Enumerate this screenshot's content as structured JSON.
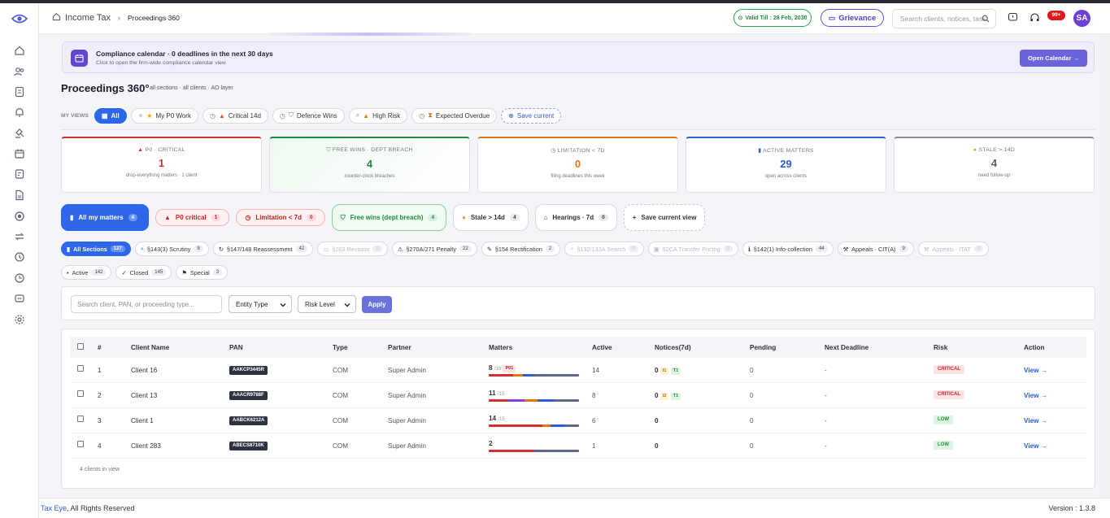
{
  "header": {
    "breadcrumb_root": "Income Tax",
    "breadcrumb_current": "Proceedings 360",
    "valid_till": "Valid Till : 28 Feb, 2030",
    "grievance": "Grievance",
    "search_placeholder": "Search clients, notices, task",
    "notif_badge": "99+",
    "avatar": "SA"
  },
  "sidebar": {
    "icons": [
      "home-icon",
      "users-icon",
      "document-icon",
      "bell-icon",
      "gavel-icon",
      "calendar-icon",
      "notes-icon",
      "file-icon",
      "target-icon",
      "transfer-icon",
      "clock-icon",
      "history-icon",
      "message-icon",
      "settings-icon"
    ]
  },
  "calendar_banner": {
    "title": "Compliance calendar · 0 deadlines in the next 30 days",
    "subtitle": "Click to open the firm-wide compliance calendar view",
    "button": "Open Calendar →"
  },
  "page": {
    "title": "Proceedings 360°",
    "subtitle": "all sections · all clients · AO layer"
  },
  "views": {
    "label": "MY VIEWS",
    "items": [
      {
        "label": "All",
        "active": true
      },
      {
        "label": "My P0 Work"
      },
      {
        "label": "Critical 14d"
      },
      {
        "label": "Defence Wins"
      },
      {
        "label": "High Risk"
      },
      {
        "label": "Expected Overdue"
      }
    ],
    "save": "Save current"
  },
  "kpis": [
    {
      "label": "P0 · CRITICAL",
      "value": "1",
      "sub": "drop-everything matters · 1 client",
      "color": "#d32f2f"
    },
    {
      "label": "FREE WINS · DEPT BREACH",
      "value": "4",
      "sub": "counter-clock breaches",
      "color": "#1e8a3f"
    },
    {
      "label": "LIMITATION < 7D",
      "value": "0",
      "sub": "filing deadlines this week",
      "color": "#e07a10"
    },
    {
      "label": "ACTIVE MATTERS",
      "value": "29",
      "sub": "open across clients",
      "color": "#2b5fd9"
    },
    {
      "label": "STALE > 14D",
      "value": "4",
      "sub": "need follow-up",
      "color": "#555a66"
    }
  ],
  "quick_filters": [
    {
      "label": "All my matters",
      "count": "4"
    },
    {
      "label": "P0 critical",
      "count": "1"
    },
    {
      "label": "Limitation < 7d",
      "count": "0"
    },
    {
      "label": "Free wins (dept breach)",
      "count": "4"
    },
    {
      "label": "Stale > 14d",
      "count": "4"
    },
    {
      "label": "Hearings · 7d",
      "count": "0"
    },
    {
      "label": "Save current view"
    }
  ],
  "sections": [
    {
      "label": "All Sections",
      "count": "127"
    },
    {
      "label": "§143(3) Scrutiny",
      "count": "8"
    },
    {
      "label": "§147/148 Reassessment",
      "count": "42"
    },
    {
      "label": "§263 Revision",
      "count": "0"
    },
    {
      "label": "§270A/271 Penalty",
      "count": "22"
    },
    {
      "label": "§154 Rectification",
      "count": "2"
    },
    {
      "label": "§132/133A Search",
      "count": "0"
    },
    {
      "label": "92CA Transfer Pricing",
      "count": "0"
    },
    {
      "label": "§142(1) Info-collection",
      "count": "44"
    },
    {
      "label": "Appeals · CIT(A)",
      "count": "9"
    },
    {
      "label": "Appeals · ITAT",
      "count": "0"
    }
  ],
  "statuses": [
    {
      "label": "Active",
      "count": "142"
    },
    {
      "label": "Closed",
      "count": "145"
    },
    {
      "label": "Special",
      "count": "3"
    }
  ],
  "filters": {
    "search_placeholder": "Search client, PAN, or proceeding type...",
    "entity_type": "Entity Type",
    "risk_level": "Risk Level",
    "apply": "Apply"
  },
  "table": {
    "columns": [
      "#",
      "Client Name",
      "PAN",
      "Type",
      "Partner",
      "Matters",
      "Active",
      "Notices(7d)",
      "Pending",
      "Next Deadline",
      "Risk",
      "Action"
    ],
    "rows": [
      {
        "num": "1",
        "client": "Client 16",
        "pan": "AAKCP3445R",
        "type": "COM",
        "partner": "Super Admin",
        "matters": "8",
        "matters_of": "/18",
        "tag": "P01",
        "active": "14",
        "notices": "0",
        "notice_tags": [
          "I1",
          "T1"
        ],
        "pending": "0",
        "deadline": "-",
        "risk": "CRITICAL",
        "action": "View →"
      },
      {
        "num": "2",
        "client": "Client 13",
        "pan": "AAACR9788F",
        "type": "COM",
        "partner": "Super Admin",
        "matters": "11",
        "matters_of": "/15",
        "tag": "",
        "active": "8",
        "notices": "0",
        "notice_tags": [
          "I2",
          "T1"
        ],
        "pending": "0",
        "deadline": "-",
        "risk": "CRITICAL",
        "action": "View →"
      },
      {
        "num": "3",
        "client": "Client 1",
        "pan": "AABCK6212A",
        "type": "COM",
        "partner": "Super Admin",
        "matters": "14",
        "matters_of": "/15",
        "tag": "",
        "active": "6",
        "notices": "0",
        "notice_tags": [],
        "pending": "0",
        "deadline": "-",
        "risk": "LOW",
        "action": "View →"
      },
      {
        "num": "4",
        "client": "Client 283",
        "pan": "ABECS8710K",
        "type": "COM",
        "partner": "Super Admin",
        "matters": "2",
        "matters_of": "",
        "tag": "",
        "active": "1",
        "notices": "0",
        "notice_tags": [],
        "pending": "0",
        "deadline": "-",
        "risk": "LOW",
        "action": "View →"
      }
    ],
    "footer": "4 clients in view"
  },
  "footer": {
    "brand": "Tax Eye",
    "rights": ", All Rights Reserved",
    "version": "Version : 1.3.8"
  }
}
